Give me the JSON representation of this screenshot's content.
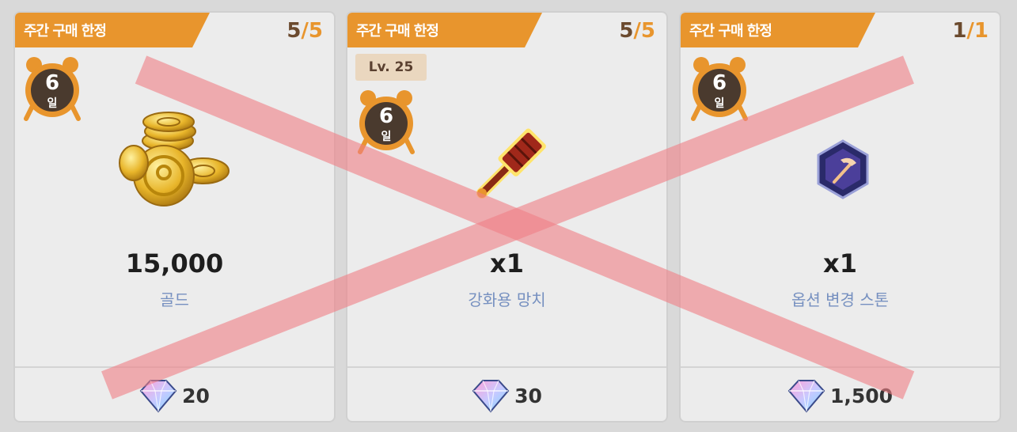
{
  "cards": [
    {
      "banner": "주간 구매 한정",
      "limit_current": "5",
      "limit_sep": "/",
      "limit_max": "5",
      "timer_value": "6",
      "timer_unit": "일",
      "item_icon": "gold-coins-icon",
      "quantity": "15,000",
      "item_name": "골드",
      "price_icon": "diamond-gem-icon",
      "price": "20"
    },
    {
      "banner": "주간 구매 한정",
      "limit_current": "5",
      "limit_sep": "/",
      "limit_max": "5",
      "level": "Lv. 25",
      "timer_value": "6",
      "timer_unit": "일",
      "item_icon": "enhancement-hammer-icon",
      "quantity": "x1",
      "item_name": "강화용 망치",
      "price_icon": "diamond-gem-icon",
      "price": "30"
    },
    {
      "banner": "주간 구매 한정",
      "limit_current": "1",
      "limit_sep": "/",
      "limit_max": "1",
      "timer_value": "6",
      "timer_unit": "일",
      "item_icon": "option-change-stone-icon",
      "quantity": "x1",
      "item_name": "옵션 변경 스톤",
      "price_icon": "diamond-gem-icon",
      "price": "1,500"
    }
  ],
  "overlay_icon": "red-cross-mark-icon",
  "colors": {
    "banner": "#e8952d",
    "item_name": "#7690c0",
    "cross": "#f07f86"
  }
}
